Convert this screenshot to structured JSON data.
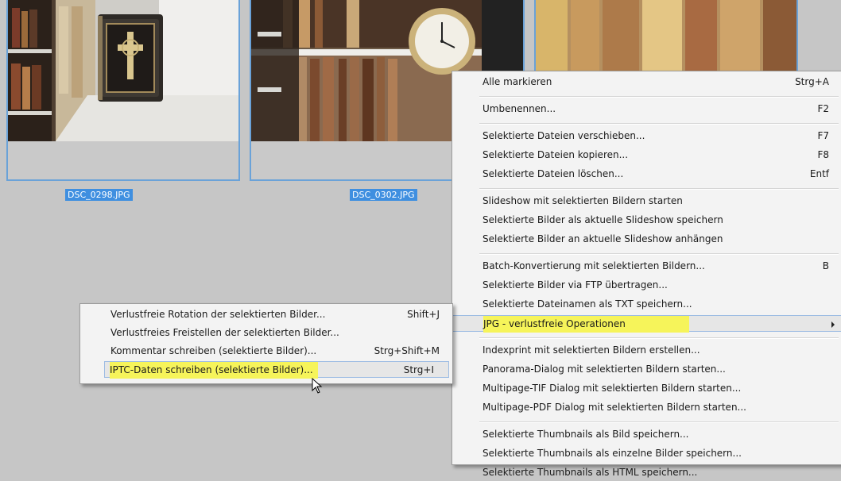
{
  "thumbnails": [
    {
      "filename": "DSC_0298.JPG"
    },
    {
      "filename": "DSC_0302.JPG"
    }
  ],
  "main_menu": {
    "groups": [
      [
        {
          "label": "Alle markieren",
          "shortcut": "Strg+A"
        }
      ],
      [
        {
          "label": "Umbenennen...",
          "shortcut": "F2"
        }
      ],
      [
        {
          "label": "Selektierte Dateien verschieben...",
          "shortcut": "F7"
        },
        {
          "label": "Selektierte Dateien kopieren...",
          "shortcut": "F8"
        },
        {
          "label": "Selektierte Dateien löschen...",
          "shortcut": "Entf"
        }
      ],
      [
        {
          "label": "Slideshow mit selektierten Bildern starten",
          "shortcut": ""
        },
        {
          "label": "Selektierte Bilder als aktuelle Slideshow speichern",
          "shortcut": ""
        },
        {
          "label": "Selektierte Bilder an aktuelle Slideshow anhängen",
          "shortcut": ""
        }
      ],
      [
        {
          "label": "Batch-Konvertierung mit selektierten Bildern...",
          "shortcut": "B"
        },
        {
          "label": "Selektierte Bilder via FTP übertragen...",
          "shortcut": ""
        },
        {
          "label": "Selektierte Dateinamen als TXT speichern...",
          "shortcut": ""
        },
        {
          "label": "JPG - verlustfreie Operationen",
          "shortcut": "",
          "submenu": true,
          "active": true
        }
      ],
      [
        {
          "label": "Indexprint mit selektierten Bildern erstellen...",
          "shortcut": ""
        },
        {
          "label": "Panorama-Dialog mit selektierten Bildern starten...",
          "shortcut": ""
        },
        {
          "label": "Multipage-TIF Dialog mit selektierten Bildern starten...",
          "shortcut": ""
        },
        {
          "label": "Multipage-PDF Dialog mit selektierten Bildern starten...",
          "shortcut": ""
        }
      ],
      [
        {
          "label": "Selektierte Thumbnails als Bild speichern...",
          "shortcut": ""
        },
        {
          "label": "Selektierte Thumbnails als einzelne Bilder speichern...",
          "shortcut": ""
        },
        {
          "label": "Selektierte Thumbnails als HTML speichern...",
          "shortcut": ""
        }
      ]
    ]
  },
  "sub_menu": {
    "items": [
      {
        "label": "Verlustfreie Rotation der selektierten Bilder...",
        "shortcut": "Shift+J"
      },
      {
        "label": "Verlustfreies Freistellen der selektierten Bilder...",
        "shortcut": ""
      },
      {
        "label": "Kommentar schreiben (selektierte Bilder)...",
        "shortcut": "Strg+Shift+M"
      },
      {
        "label": "IPTC-Daten schreiben (selektierte Bilder)...",
        "shortcut": "Strg+I",
        "hover": true
      }
    ]
  },
  "colors": {
    "background": "#c6c6c6",
    "selection_blue": "#3f8fe0",
    "thumb_border": "#6aa2d8",
    "highlight_yellow": "#f6f45a"
  }
}
